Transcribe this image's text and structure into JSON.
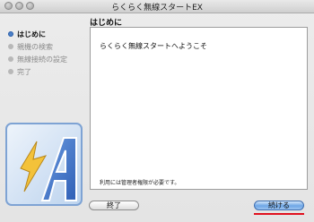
{
  "window": {
    "title": "らくらく無線スタートEX"
  },
  "sidebar": {
    "steps": [
      {
        "label": "はじめに",
        "active": true
      },
      {
        "label": "親機の検索",
        "active": false
      },
      {
        "label": "無線接続の設定",
        "active": false
      },
      {
        "label": "完了",
        "active": false
      }
    ]
  },
  "main": {
    "heading": "はじめに",
    "welcome_text": "らくらく無線スタートへようこそ",
    "admin_note": "利用には管理者権限が必要です。"
  },
  "buttons": {
    "quit_label": "終了",
    "continue_label": "続ける"
  },
  "colors": {
    "active_bullet": "#4a7fc8",
    "default_button": "#6ea6e6",
    "annotation_underline": "#e0101e"
  }
}
